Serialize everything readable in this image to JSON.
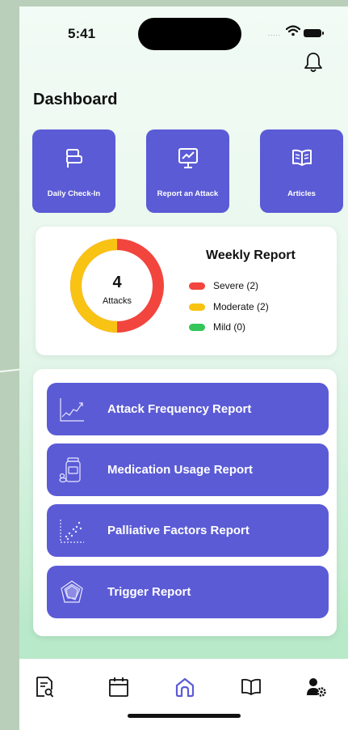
{
  "status": {
    "time": "5:41",
    "signal_dots": "....."
  },
  "header": {
    "title": "Dashboard"
  },
  "quick_actions": [
    {
      "label": "Daily Check-In",
      "icon": "checkin-icon"
    },
    {
      "label": "Report an Attack",
      "icon": "monitor-chart-icon"
    },
    {
      "label": "Articles",
      "icon": "book-icon"
    }
  ],
  "weekly_report": {
    "title": "Weekly Report",
    "count": "4",
    "count_label": "Attacks",
    "legend": [
      {
        "label": "Severe (2)",
        "color": "#f2453d",
        "value": 2
      },
      {
        "label": "Moderate (2)",
        "color": "#f9c314",
        "value": 2
      },
      {
        "label": "Mild (0)",
        "color": "#34c659",
        "value": 0
      }
    ]
  },
  "reports": [
    {
      "label": "Attack Frequency Report",
      "icon": "line-chart-icon"
    },
    {
      "label": "Medication Usage Report",
      "icon": "pill-bottle-icon"
    },
    {
      "label": "Palliative Factors Report",
      "icon": "scatter-plot-icon"
    },
    {
      "label": "Trigger Report",
      "icon": "radar-chart-icon"
    }
  ],
  "tabbar": {
    "items": [
      "search-document-icon",
      "calendar-icon",
      "home-icon",
      "book-icon",
      "user-settings-icon"
    ],
    "active": "home-icon",
    "active_color": "#5b5bd6"
  },
  "colors": {
    "accent": "#5b5bd6"
  }
}
